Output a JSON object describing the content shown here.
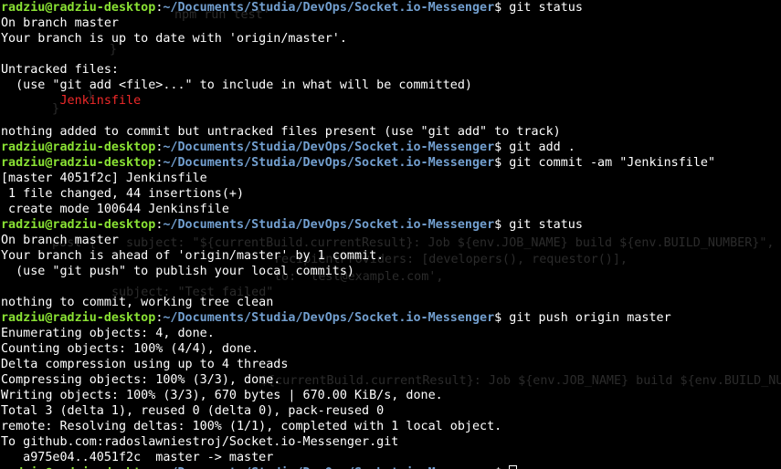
{
  "prompt": {
    "user": "radziu@radziu-desktop",
    "colon": ":",
    "path": "~/Documents/Studia/DevOps/Socket.io-Messenger",
    "dollar": "$"
  },
  "colors": {
    "background": "#000000",
    "text": "#ffffff",
    "user": "#8ae234",
    "path": "#729fcf",
    "untracked": "#ef2929"
  },
  "lines": [
    {
      "type": "prompt",
      "cmd": " git status"
    },
    {
      "type": "text",
      "text": "On branch master"
    },
    {
      "type": "text",
      "text": "Your branch is up to date with 'origin/master'."
    },
    {
      "type": "text",
      "text": ""
    },
    {
      "type": "text",
      "text": "Untracked files:"
    },
    {
      "type": "text",
      "text": "  (use \"git add <file>...\" to include in what will be committed)"
    },
    {
      "type": "red",
      "text": "\tJenkinsfile"
    },
    {
      "type": "text",
      "text": ""
    },
    {
      "type": "text",
      "text": "nothing added to commit but untracked files present (use \"git add\" to track)"
    },
    {
      "type": "prompt",
      "cmd": " git add ."
    },
    {
      "type": "prompt",
      "cmd": " git commit -am \"Jenkinsfile\""
    },
    {
      "type": "text",
      "text": "[master 4051f2c] Jenkinsfile"
    },
    {
      "type": "text",
      "text": " 1 file changed, 44 insertions(+)"
    },
    {
      "type": "text",
      "text": " create mode 100644 Jenkinsfile"
    },
    {
      "type": "prompt",
      "cmd": " git status"
    },
    {
      "type": "text",
      "text": "On branch master"
    },
    {
      "type": "text",
      "text": "Your branch is ahead of 'origin/master' by 1 commit."
    },
    {
      "type": "text",
      "text": "  (use \"git push\" to publish your local commits)"
    },
    {
      "type": "text",
      "text": ""
    },
    {
      "type": "text",
      "text": "nothing to commit, working tree clean"
    },
    {
      "type": "prompt",
      "cmd": " git push origin master"
    },
    {
      "type": "text",
      "text": "Enumerating objects: 4, done."
    },
    {
      "type": "text",
      "text": "Counting objects: 100% (4/4), done."
    },
    {
      "type": "text",
      "text": "Delta compression using up to 4 threads"
    },
    {
      "type": "text",
      "text": "Compressing objects: 100% (3/3), done."
    },
    {
      "type": "text",
      "text": "Writing objects: 100% (3/3), 670 bytes | 670.00 KiB/s, done."
    },
    {
      "type": "text",
      "text": "Total 3 (delta 1), reused 0 (delta 0), pack-reused 0"
    },
    {
      "type": "text",
      "text": "remote: Resolving deltas: 100% (1/1), completed with 1 local object."
    },
    {
      "type": "text",
      "text": "To github.com:radoslawniestroj/Socket.io-Messenger.git"
    },
    {
      "type": "text",
      "text": "   a975e04..4051f2c  master -> master"
    },
    {
      "type": "prompt_cursor",
      "cmd": " "
    }
  ],
  "ghost_text": [
    "npm run test'",
    "}",
    "}",
    "}",
    "post {",
    "subject: \"${currentBuild.currentResult}: Job ${env.JOB_NAME} build ${env.BUILD_NUMBER}\",",
    "recipientProviders: [developers(), requestor()],",
    "to: 'test@example.com',",
    "subject: \"Test failed\"",
    "${currentBuild.currentResult}: Job ${env.JOB_NAME} build ${env.BUILD_NUMBER}\","
  ]
}
